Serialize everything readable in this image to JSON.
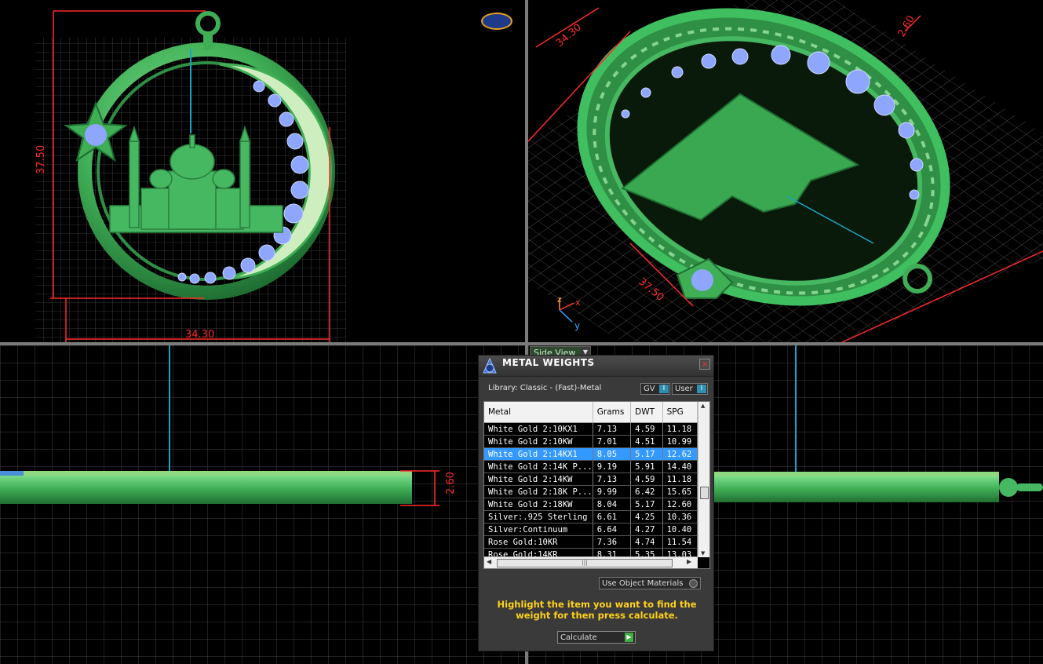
{
  "viewports": {
    "front": {
      "dimension_height": "37.50",
      "dimension_width": "34.30"
    },
    "perspective": {
      "dimension_a": "34.30",
      "dimension_b": "37.50",
      "dimension_c": "2.60",
      "axis_x": "x",
      "axis_y": "y",
      "axis_z": "z"
    },
    "side_left": {
      "dimension_thickness": "2.60"
    },
    "side_right": {
      "view_label": "Side View"
    }
  },
  "panel": {
    "title": "METAL WEIGHTS",
    "close_glyph": "✕",
    "library": "Library: Classic - (Fast)-Metal",
    "gv_label": "GV",
    "user_label": "User",
    "toggle_glyph": "I",
    "columns": [
      "Metal",
      "Grams",
      "DWT",
      "SPG"
    ],
    "rows": [
      {
        "metal": "White Gold 2:10KX1",
        "grams": "7.13",
        "dwt": "4.59",
        "spg": "11.18"
      },
      {
        "metal": "White Gold 2:10KW",
        "grams": "7.01",
        "dwt": "4.51",
        "spg": "10.99"
      },
      {
        "metal": "White Gold 2:14KX1",
        "grams": "8.05",
        "dwt": "5.17",
        "spg": "12.62"
      },
      {
        "metal": "White Gold 2:14K P...",
        "grams": "9.19",
        "dwt": "5.91",
        "spg": "14.40"
      },
      {
        "metal": "White Gold 2:14KW",
        "grams": "7.13",
        "dwt": "4.59",
        "spg": "11.18"
      },
      {
        "metal": "White Gold 2:18K P...",
        "grams": "9.99",
        "dwt": "6.42",
        "spg": "15.65"
      },
      {
        "metal": "White Gold 2:18KW",
        "grams": "8.04",
        "dwt": "5.17",
        "spg": "12.60"
      },
      {
        "metal": "Silver:.925 Sterling",
        "grams": "6.61",
        "dwt": "4.25",
        "spg": "10.36"
      },
      {
        "metal": "Silver:Continuum",
        "grams": "6.64",
        "dwt": "4.27",
        "spg": "10.40"
      },
      {
        "metal": "Rose Gold:10KR",
        "grams": "7.36",
        "dwt": "4.74",
        "spg": "11.54"
      },
      {
        "metal": "Rose Gold:14KR",
        "grams": "8.31",
        "dwt": "5.35",
        "spg": "13.03"
      }
    ],
    "selected_row": 2,
    "use_object_materials": "Use Object Materials",
    "instructions": "Highlight the item you want to find the weight for then press calculate.",
    "calculate_label": "Calculate",
    "calculate_glyph": "▶",
    "scroll_thumb_glyph": "|||"
  },
  "colors": {
    "model_green": "#3fbf5f",
    "gem_blue": "#8fa6ff",
    "dimension_red": "#ff2a2a",
    "selection_blue": "#3399ff",
    "instruction_yellow": "#ffd21a"
  }
}
